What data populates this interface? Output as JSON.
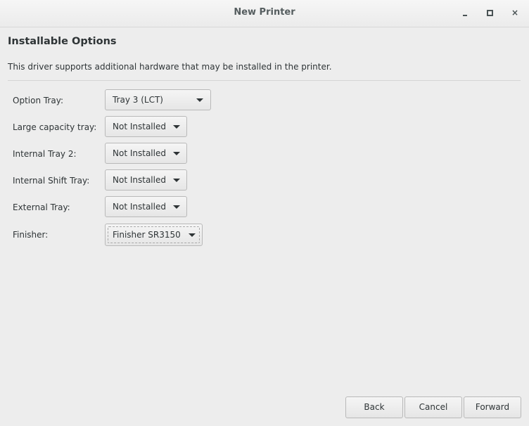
{
  "window": {
    "title": "New Printer",
    "controls": {
      "minimize": "minimize",
      "maximize": "maximize",
      "close": "×"
    }
  },
  "page": {
    "heading": "Installable Options",
    "description": "This driver supports additional hardware that may be installed in the printer."
  },
  "options": [
    {
      "label": "Option Tray:",
      "value": "Tray 3 (LCT)"
    },
    {
      "label": "Large capacity tray:",
      "value": "Not Installed"
    },
    {
      "label": "Internal Tray 2:",
      "value": "Not Installed"
    },
    {
      "label": "Internal Shift Tray:",
      "value": "Not Installed"
    },
    {
      "label": "External Tray:",
      "value": "Not Installed"
    },
    {
      "label": "Finisher:",
      "value": "Finisher SR3150",
      "focused": true
    }
  ],
  "buttons": {
    "back": "Back",
    "cancel": "Cancel",
    "forward": "Forward"
  }
}
